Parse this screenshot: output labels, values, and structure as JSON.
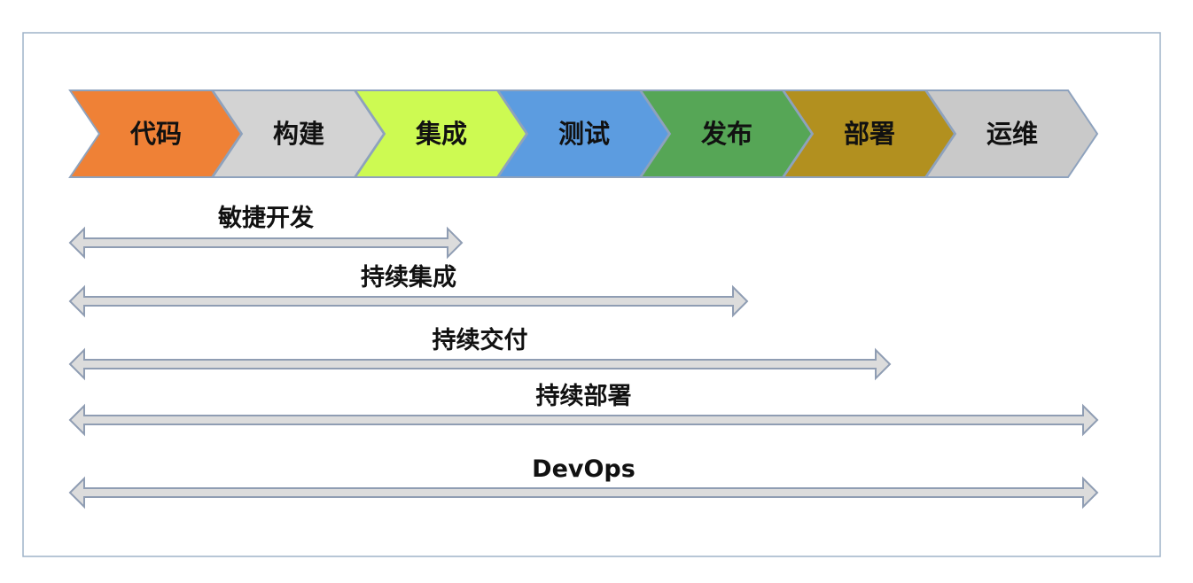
{
  "stages": [
    {
      "label": "代码",
      "color": "#ef8136"
    },
    {
      "label": "构建",
      "color": "#d3d3d3"
    },
    {
      "label": "集成",
      "color": "#cdfa52"
    },
    {
      "label": "测试",
      "color": "#5c9ce0"
    },
    {
      "label": "发布",
      "color": "#56a656"
    },
    {
      "label": "部署",
      "color": "#b2901f"
    },
    {
      "label": "运维",
      "color": "#c9c9c9"
    }
  ],
  "spans": [
    {
      "label": "敏捷开发",
      "end_stage": "集成"
    },
    {
      "label": "持续集成",
      "end_stage": "发布"
    },
    {
      "label": "持续交付",
      "end_stage": "部署"
    },
    {
      "label": "持续部署",
      "end_stage": "运维"
    },
    {
      "label": "DevOps",
      "end_stage": "运维"
    }
  ]
}
